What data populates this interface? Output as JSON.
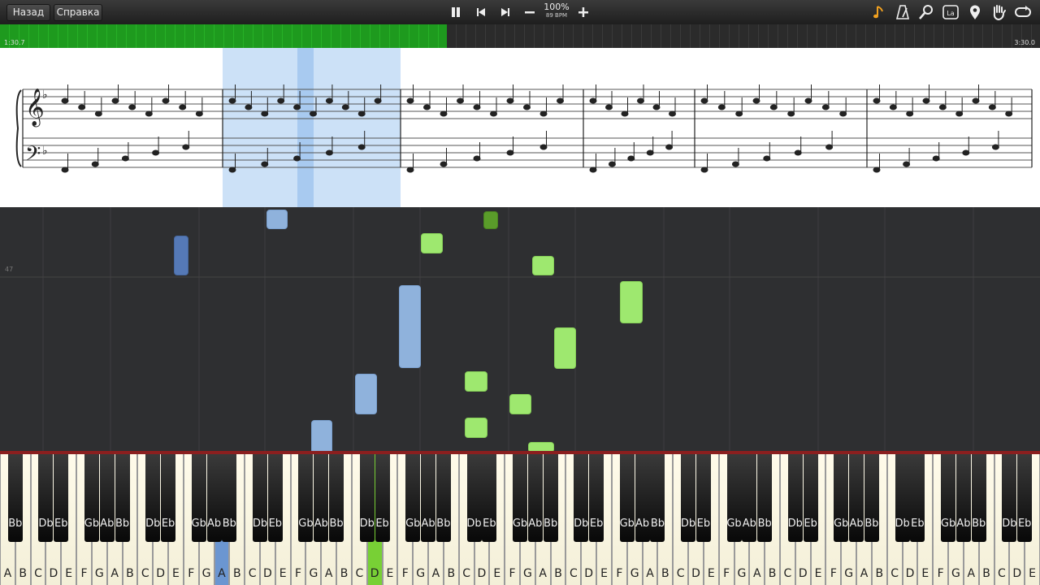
{
  "toolbar": {
    "back_label": "Назад",
    "help_label": "Справка",
    "zoom": "100%",
    "tempo": "89 BPM",
    "note_label_icon": "La"
  },
  "progress": {
    "elapsed": "1:30.7",
    "total": "3:30.0",
    "fraction": 0.43
  },
  "roll": {
    "measure_number": "47"
  },
  "keyboard": {
    "white_keys": [
      "A",
      "B",
      "C",
      "D",
      "E",
      "F",
      "G",
      "A",
      "B",
      "C",
      "D",
      "E",
      "F",
      "G",
      "A",
      "B",
      "C",
      "D",
      "E",
      "F",
      "G",
      "A",
      "B",
      "C",
      "D",
      "E",
      "F",
      "G",
      "A",
      "B",
      "C",
      "D",
      "E",
      "F",
      "G",
      "A",
      "B",
      "C",
      "D",
      "E",
      "F",
      "G",
      "A",
      "B",
      "C",
      "D",
      "E",
      "F",
      "G",
      "A",
      "B",
      "C",
      "D",
      "E",
      "F",
      "G",
      "A",
      "B",
      "C",
      "D",
      "E",
      "F",
      "G",
      "A",
      "B",
      "C",
      "D",
      "E"
    ],
    "pressed": [
      {
        "index": 14,
        "hand": "left",
        "color": "#6b96d1"
      },
      {
        "index": 24,
        "hand": "right",
        "color": "#78d035"
      }
    ],
    "black_keys": [
      "Bb",
      "Db",
      "Eb",
      "Gb",
      "Ab",
      "Bb",
      "Db",
      "Eb",
      "Gb",
      "Ab",
      "Bb",
      "Db",
      "Eb",
      "Gb",
      "Ab",
      "Bb",
      "Db",
      "Eb",
      "Gb",
      "Ab",
      "Bb",
      "Db",
      "Eb",
      "Gb",
      "Ab",
      "Bb",
      "Db",
      "Eb",
      "Gb",
      "Ab",
      "Bb",
      "Db",
      "Eb",
      "Gb",
      "Ab",
      "Bb",
      "Db",
      "Eb",
      "Gb",
      "Ab",
      "Bb",
      "Db",
      "Eb",
      "Gb",
      "Ab",
      "Bb",
      "Db",
      "Eb"
    ]
  },
  "colors": {
    "left_hand": "#8fb2dc",
    "right_hand": "#9ee86f",
    "progress": "#1e9a1e"
  }
}
